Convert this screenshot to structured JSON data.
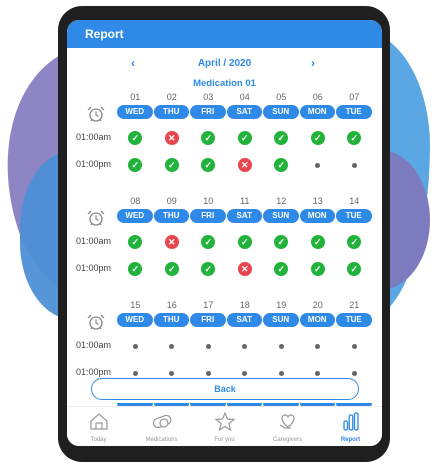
{
  "header": {
    "title": "Report"
  },
  "nav": {
    "prev": "‹",
    "month": "April / 2020",
    "next": "›"
  },
  "medication": "Medication 01",
  "days": [
    "WED",
    "THU",
    "FRI",
    "SAT",
    "SUN",
    "MON",
    "TUE"
  ],
  "weeks": [
    {
      "dates": [
        "01",
        "02",
        "03",
        "04",
        "05",
        "06",
        "07"
      ],
      "rows": [
        {
          "time": "01:00am",
          "status": [
            "taken",
            "missed",
            "taken",
            "taken",
            "taken",
            "taken",
            "taken"
          ]
        },
        {
          "time": "01:00pm",
          "status": [
            "taken",
            "taken",
            "taken",
            "missed",
            "taken",
            "pending",
            "pending"
          ]
        }
      ]
    },
    {
      "dates": [
        "08",
        "09",
        "10",
        "11",
        "12",
        "13",
        "14"
      ],
      "rows": [
        {
          "time": "01:00am",
          "status": [
            "taken",
            "missed",
            "taken",
            "taken",
            "taken",
            "taken",
            "taken"
          ]
        },
        {
          "time": "01:00pm",
          "status": [
            "taken",
            "taken",
            "taken",
            "missed",
            "taken",
            "taken",
            "taken"
          ]
        }
      ]
    },
    {
      "dates": [
        "15",
        "16",
        "17",
        "18",
        "19",
        "20",
        "21"
      ],
      "rows": [
        {
          "time": "01:00am",
          "status": [
            "pending",
            "pending",
            "pending",
            "pending",
            "pending",
            "pending",
            "pending"
          ]
        },
        {
          "time": "01:00pm",
          "status": [
            "pending",
            "pending",
            "pending",
            "pending",
            "pending",
            "pending",
            "pending"
          ]
        }
      ]
    }
  ],
  "back_label": "Back",
  "tabs": [
    {
      "label": "Today",
      "icon": "home-icon",
      "active": false
    },
    {
      "label": "Medications",
      "icon": "pill-icon",
      "active": false
    },
    {
      "label": "For you",
      "icon": "star-icon",
      "active": false
    },
    {
      "label": "Caregivers",
      "icon": "heart-hand-icon",
      "active": false
    },
    {
      "label": "Report",
      "icon": "bar-chart-icon",
      "active": true
    }
  ],
  "colors": {
    "accent": "#2e8ae6",
    "taken": "#22b33c",
    "missed": "#e8454d",
    "pending": "#666666"
  }
}
